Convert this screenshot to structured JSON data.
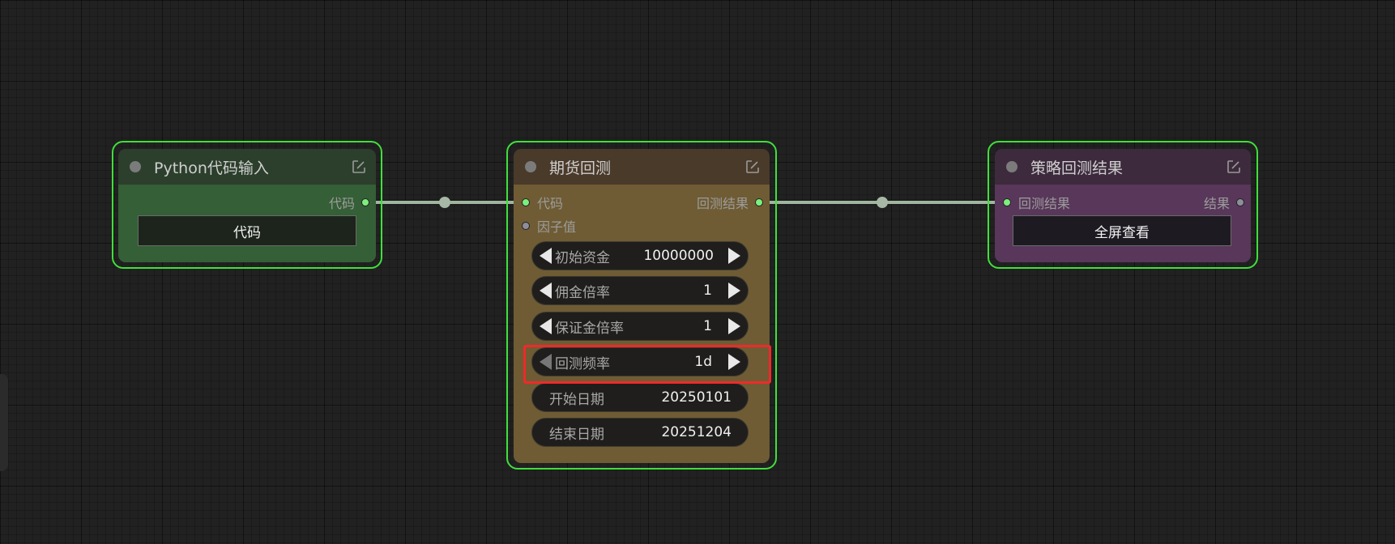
{
  "nodes": {
    "python_input": {
      "title": "Python代码输入",
      "output_label": "代码",
      "button_label": "代码",
      "header_color": "#2c3f2c",
      "body_color": "#355f36"
    },
    "backtest": {
      "title": "期货回测",
      "input_code": "代码",
      "input_factor": "因子值",
      "output_result": "回测结果",
      "header_color": "#4a3a2a",
      "body_color": "#6f5c34",
      "widgets": [
        {
          "label": "初始资金",
          "value": "10000000"
        },
        {
          "label": "佣金倍率",
          "value": "1"
        },
        {
          "label": "保证金倍率",
          "value": "1"
        },
        {
          "label": "回测频率",
          "value": "1d"
        }
      ],
      "text_widgets": [
        {
          "label": "开始日期",
          "value": "20250101"
        },
        {
          "label": "结束日期",
          "value": "20251204"
        }
      ]
    },
    "result": {
      "title": "策略回测结果",
      "input_label": "回测结果",
      "output_label": "结果",
      "button_label": "全屏查看",
      "header_color": "#3d2b3d",
      "body_color": "#58375a"
    }
  },
  "colors": {
    "selection": "#3fe03a",
    "highlight": "#ef2a2a",
    "link": "#9fb59f",
    "slot_active": "#7cf07c"
  },
  "icons": {
    "edit": "edit-square-icon",
    "head": "node-status-dot-icon"
  }
}
